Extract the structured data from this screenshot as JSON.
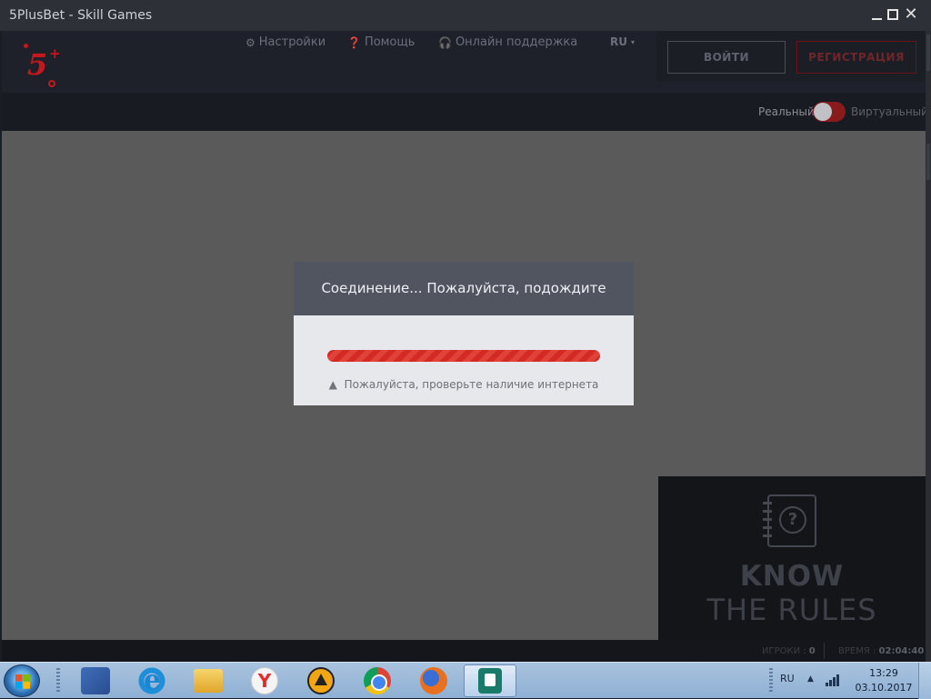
{
  "window": {
    "title": "5PlusBet - Skill Games",
    "close_glyph": "✕"
  },
  "header": {
    "logo_text": "5",
    "logo_plus": "+",
    "nav": {
      "settings_icon": "gear-icon",
      "settings": "Настройки",
      "help_icon": "question-circle-icon",
      "help": "Помощь",
      "support_icon": "headset-icon",
      "support": "Онлайн поддержка",
      "language": "RU"
    },
    "login_label": "ВОЙТИ",
    "register_label": "РЕГИСТРАЦИЯ"
  },
  "mode": {
    "real": "Реальный",
    "virtual": "Виртуальный",
    "active": "Реальный"
  },
  "modal": {
    "title": "Соединение... Пожалуйста, подождите",
    "warning": "Пожалуйста, проверьте наличие интернета"
  },
  "rules_panel": {
    "line1": "KNOW",
    "line2": "THE RULES"
  },
  "footer": {
    "players_label": "ИГРОКИ :",
    "players_value": "0",
    "time_label": "ВРЕМЯ :",
    "time_value": "02:04:40"
  },
  "taskbar": {
    "items": [
      "start-orb",
      "user-manager",
      "internet-explorer",
      "file-explorer",
      "yandex-browser",
      "aimp",
      "chrome",
      "firefox",
      "5plusbet-app"
    ],
    "tray_language": "RU",
    "clock_time": "13:29",
    "clock_date": "03.10.2017"
  },
  "colors": {
    "accent_red": "#c4171e",
    "modal_header": "#51555f",
    "overlay": "#5a5a5a"
  }
}
